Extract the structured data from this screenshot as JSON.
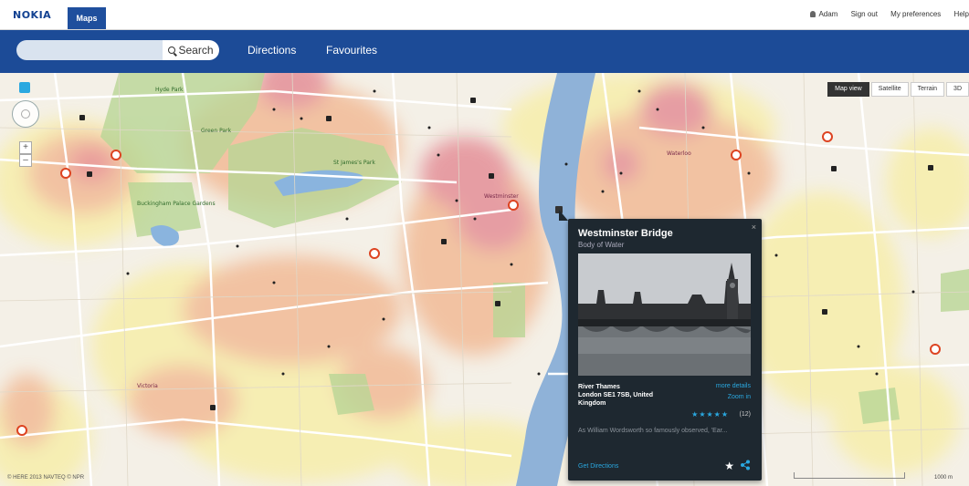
{
  "topbar": {
    "logo": "NOKIA",
    "tab": "Maps",
    "user": "Adam",
    "sign_out": "Sign out",
    "preferences": "My preferences",
    "help": "Help"
  },
  "searchbar": {
    "placeholder": "",
    "search_label": "Search",
    "directions": "Directions",
    "favourites": "Favourites"
  },
  "map": {
    "view_buttons": [
      "Map view",
      "Satellite",
      "Terrain",
      "3D"
    ],
    "active_view": "Map view",
    "copyright": "© HERE 2013 NAVTEQ © NPR",
    "scale_label": "1000 m",
    "place_labels": [
      "Hyde Park",
      "Green Park",
      "St James's Park",
      "Buckingham Palace Gardens",
      "Westminster",
      "Victoria",
      "Waterloo"
    ],
    "colors": {
      "heat_red": "#e89a96",
      "heat_orange": "#f4c2a0",
      "heat_yellow": "#f6f0b0",
      "park": "#bcd99a",
      "water": "#8ab4de",
      "road": "#ffffff"
    }
  },
  "card": {
    "title": "Westminster Bridge",
    "subtitle": "Body of Water",
    "address_line1": "River Thames",
    "address_line2": "London SE1 7SB, United Kingdom",
    "more_details": "more details",
    "zoom_in": "Zoom in",
    "rating_stars": "★★★★★",
    "rating_count": "(12)",
    "quote": "As William Wordsworth so famously observed, 'Ear...",
    "get_directions": "Get Directions",
    "close": "×"
  }
}
